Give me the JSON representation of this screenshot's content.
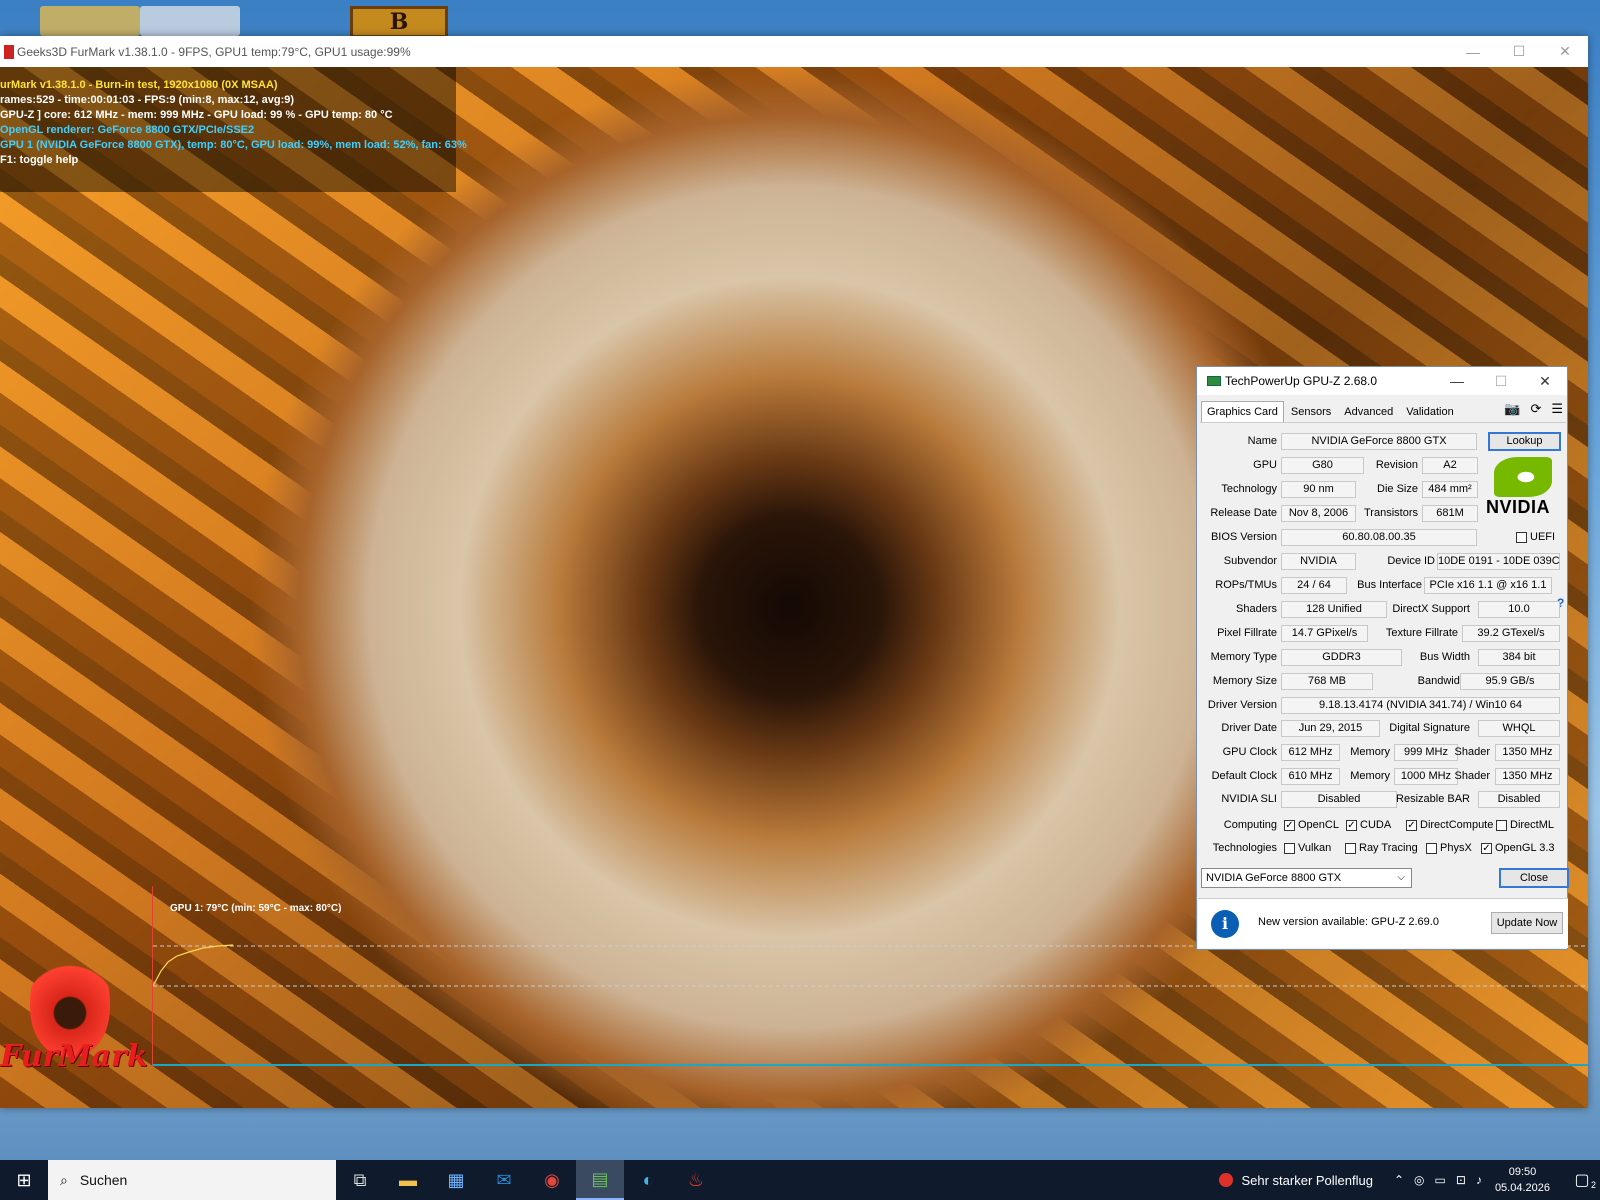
{
  "desktop": {
    "game_icon_letter": "B"
  },
  "furmark": {
    "title": "Geeks3D FurMark v1.38.1.0 - 9FPS, GPU1 temp:79°C, GPU1 usage:99%",
    "osd": [
      "urMark v1.38.1.0 - Burn-in test, 1920x1080 (0X MSAA)",
      "rames:529 - time:00:01:03 - FPS:9 (min:8, max:12, avg:9)",
      "GPU-Z ] core: 612 MHz - mem: 999 MHz - GPU load: 99 % - GPU temp: 80 °C",
      "OpenGL renderer: GeForce 8800 GTX/PCIe/SSE2",
      "GPU 1 (NVIDIA GeForce 8800 GTX), temp: 80°C, GPU load: 99%, mem load: 52%, fan: 63%",
      "F1: toggle help"
    ],
    "graph_label": "GPU 1: 79°C (min: 59°C - max: 80°C)",
    "logo_text": "FurMark"
  },
  "gpuz": {
    "title": "TechPowerUp GPU-Z 2.68.0",
    "tabs": [
      "Graphics Card",
      "Sensors",
      "Advanced",
      "Validation"
    ],
    "labels": {
      "name": "Name",
      "gpu": "GPU",
      "revision": "Revision",
      "technology": "Technology",
      "die_size": "Die Size",
      "release_date": "Release Date",
      "transistors": "Transistors",
      "bios_version": "BIOS Version",
      "uefi": "UEFI",
      "subvendor": "Subvendor",
      "device_id": "Device ID",
      "rops": "ROPs/TMUs",
      "bus_interface": "Bus Interface",
      "shaders": "Shaders",
      "directx": "DirectX Support",
      "pixel_fillrate": "Pixel Fillrate",
      "texture_fillrate": "Texture Fillrate",
      "memory_type": "Memory Type",
      "bus_width": "Bus Width",
      "memory_size": "Memory Size",
      "bandwidth": "Bandwidth",
      "driver_version": "Driver Version",
      "driver_date": "Driver Date",
      "digital_signature": "Digital Signature",
      "gpu_clock": "GPU Clock",
      "memory": "Memory",
      "shader": "Shader",
      "default_clock": "Default Clock",
      "nvidia_sli": "NVIDIA SLI",
      "resizable_bar": "Resizable BAR",
      "computing": "Computing",
      "technologies": "Technologies"
    },
    "values": {
      "name": "NVIDIA GeForce 8800 GTX",
      "gpu": "G80",
      "revision": "A2",
      "technology": "90 nm",
      "die_size": "484 mm²",
      "release_date": "Nov 8, 2006",
      "transistors": "681M",
      "bios_version": "60.80.08.00.35",
      "subvendor": "NVIDIA",
      "device_id": "10DE 0191 - 10DE 039C",
      "rops": "24 / 64",
      "bus_interface": "PCIe x16 1.1 @ x16 1.1",
      "shaders": "128 Unified",
      "directx": "10.0",
      "pixel_fillrate": "14.7 GPixel/s",
      "texture_fillrate": "39.2 GTexel/s",
      "memory_type": "GDDR3",
      "bus_width": "384 bit",
      "memory_size": "768 MB",
      "bandwidth": "95.9 GB/s",
      "driver_version": "9.18.13.4174 (NVIDIA 341.74) / Win10 64",
      "driver_date": "Jun 29, 2015",
      "digital_signature": "WHQL",
      "gpu_clock": "612 MHz",
      "gpu_memory": "999 MHz",
      "gpu_shader": "1350 MHz",
      "default_clock": "610 MHz",
      "default_memory": "1000 MHz",
      "default_shader": "1350 MHz",
      "nvidia_sli": "Disabled",
      "resizable_bar": "Disabled"
    },
    "computing": [
      {
        "label": "OpenCL",
        "checked": true
      },
      {
        "label": "CUDA",
        "checked": true
      },
      {
        "label": "DirectCompute",
        "checked": true
      },
      {
        "label": "DirectML",
        "checked": false
      }
    ],
    "technologies": [
      {
        "label": "Vulkan",
        "checked": false
      },
      {
        "label": "Ray Tracing",
        "checked": false
      },
      {
        "label": "PhysX",
        "checked": false
      },
      {
        "label": "OpenGL 3.3",
        "checked": true
      }
    ],
    "lookup_label": "Lookup",
    "nvidia_logo_text": "NVIDIA",
    "selected_card": "NVIDIA GeForce 8800 GTX",
    "close_label": "Close",
    "update_text": "New version available: GPU-Z 2.69.0",
    "update_label": "Update Now"
  },
  "taskbar": {
    "search_placeholder": "Suchen",
    "weather": "Sehr starker Pollenflug",
    "time": "09:50",
    "date": "05.04.2026",
    "notification_count": "2"
  }
}
